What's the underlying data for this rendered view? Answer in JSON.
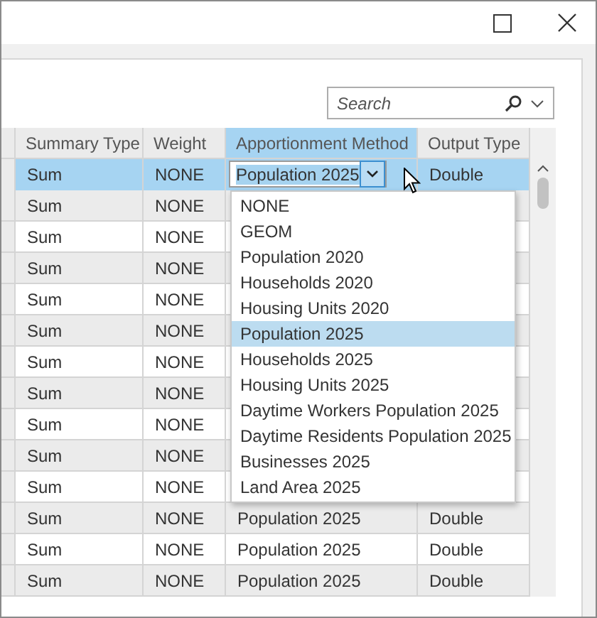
{
  "search": {
    "placeholder": "Search"
  },
  "columns": [
    {
      "label": "Summary Type",
      "highlighted": false
    },
    {
      "label": "Weight",
      "highlighted": false
    },
    {
      "label": "Apportionment Method",
      "highlighted": true
    },
    {
      "label": "Output Type",
      "highlighted": false
    }
  ],
  "rows": [
    {
      "selected": true,
      "summary_type": "Sum",
      "weight": "NONE",
      "apportionment": "Population 2025",
      "output_type": "Double"
    },
    {
      "selected": false,
      "summary_type": "Sum",
      "weight": "NONE"
    },
    {
      "selected": false,
      "summary_type": "Sum",
      "weight": "NONE"
    },
    {
      "selected": false,
      "summary_type": "Sum",
      "weight": "NONE"
    },
    {
      "selected": false,
      "summary_type": "Sum",
      "weight": "NONE"
    },
    {
      "selected": false,
      "summary_type": "Sum",
      "weight": "NONE"
    },
    {
      "selected": false,
      "summary_type": "Sum",
      "weight": "NONE"
    },
    {
      "selected": false,
      "summary_type": "Sum",
      "weight": "NONE"
    },
    {
      "selected": false,
      "summary_type": "Sum",
      "weight": "NONE"
    },
    {
      "selected": false,
      "summary_type": "Sum",
      "weight": "NONE"
    },
    {
      "selected": false,
      "summary_type": "Sum",
      "weight": "NONE"
    },
    {
      "selected": false,
      "summary_type": "Sum",
      "weight": "NONE",
      "apportionment": "Population 2025",
      "output_type": "Double"
    },
    {
      "selected": false,
      "summary_type": "Sum",
      "weight": "NONE",
      "apportionment": "Population 2025",
      "output_type": "Double"
    },
    {
      "selected": false,
      "summary_type": "Sum",
      "weight": "NONE",
      "apportionment": "Population 2025",
      "output_type": "Double"
    }
  ],
  "dropdown": {
    "options": [
      {
        "label": "NONE",
        "selected": false
      },
      {
        "label": "GEOM",
        "selected": false
      },
      {
        "label": "Population 2020",
        "selected": false
      },
      {
        "label": "Households 2020",
        "selected": false
      },
      {
        "label": "Housing Units 2020",
        "selected": false
      },
      {
        "label": "Population 2025",
        "selected": true
      },
      {
        "label": "Households 2025",
        "selected": false
      },
      {
        "label": "Housing Units 2025",
        "selected": false
      },
      {
        "label": "Daytime Workers Population 2025",
        "selected": false
      },
      {
        "label": "Daytime Residents Population 2025",
        "selected": false
      },
      {
        "label": "Businesses 2025",
        "selected": false
      },
      {
        "label": "Land Area 2025",
        "selected": false
      }
    ]
  }
}
